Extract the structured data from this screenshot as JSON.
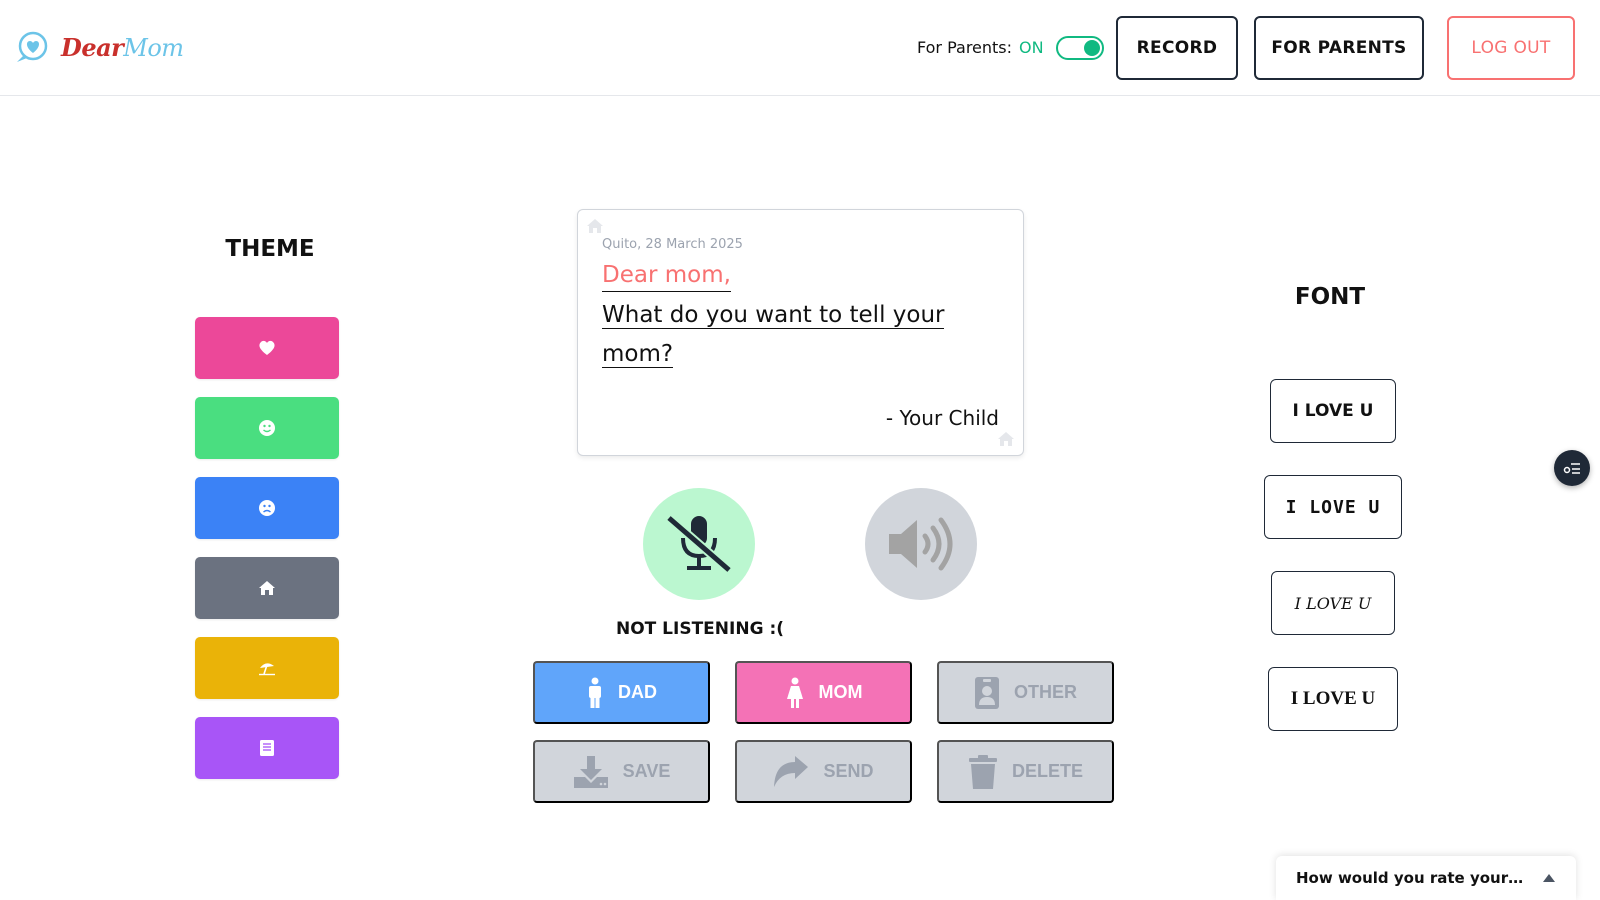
{
  "header": {
    "logo_dear": "Dear",
    "logo_mom": "Mom",
    "parents_label": "For Parents:",
    "parents_state": "ON",
    "record_label": "RECORD",
    "for_parents_label": "FOR PARENTS",
    "logout_label": "LOG OUT"
  },
  "theme": {
    "title": "THEME",
    "buttons": [
      {
        "icon": "heart-icon",
        "color": "#ec4899"
      },
      {
        "icon": "smile-icon",
        "color": "#4ade80"
      },
      {
        "icon": "frown-icon",
        "color": "#3b82f6"
      },
      {
        "icon": "home-icon",
        "color": "#6b7280"
      },
      {
        "icon": "beach-umbrella-icon",
        "color": "#eab308"
      },
      {
        "icon": "book-icon",
        "color": "#a855f7"
      }
    ]
  },
  "card": {
    "date": "Quito, 28 March 2025",
    "greeting": "Dear mom,",
    "body_line1": "What do you want to tell your",
    "body_line2": "mom?",
    "signature": "- Your Child"
  },
  "audio": {
    "mic_state": "muted",
    "status": "NOT LISTENING :("
  },
  "actions": {
    "dad": "DAD",
    "mom": "MOM",
    "other": "OTHER",
    "save": "SAVE",
    "send": "SEND",
    "delete": "DELETE"
  },
  "font": {
    "title": "FONT",
    "options": [
      "I LOVE U",
      "I LOVE U",
      "I LOVE U",
      "I LOVE U"
    ]
  },
  "rating": {
    "text": "How would you rate your exper..."
  },
  "colors": {
    "accent_green": "#10b981",
    "logout_red": "#f87171",
    "dad_blue": "#60a5fa",
    "mom_pink": "#f472b6",
    "disabled_gray": "#d1d5db"
  }
}
